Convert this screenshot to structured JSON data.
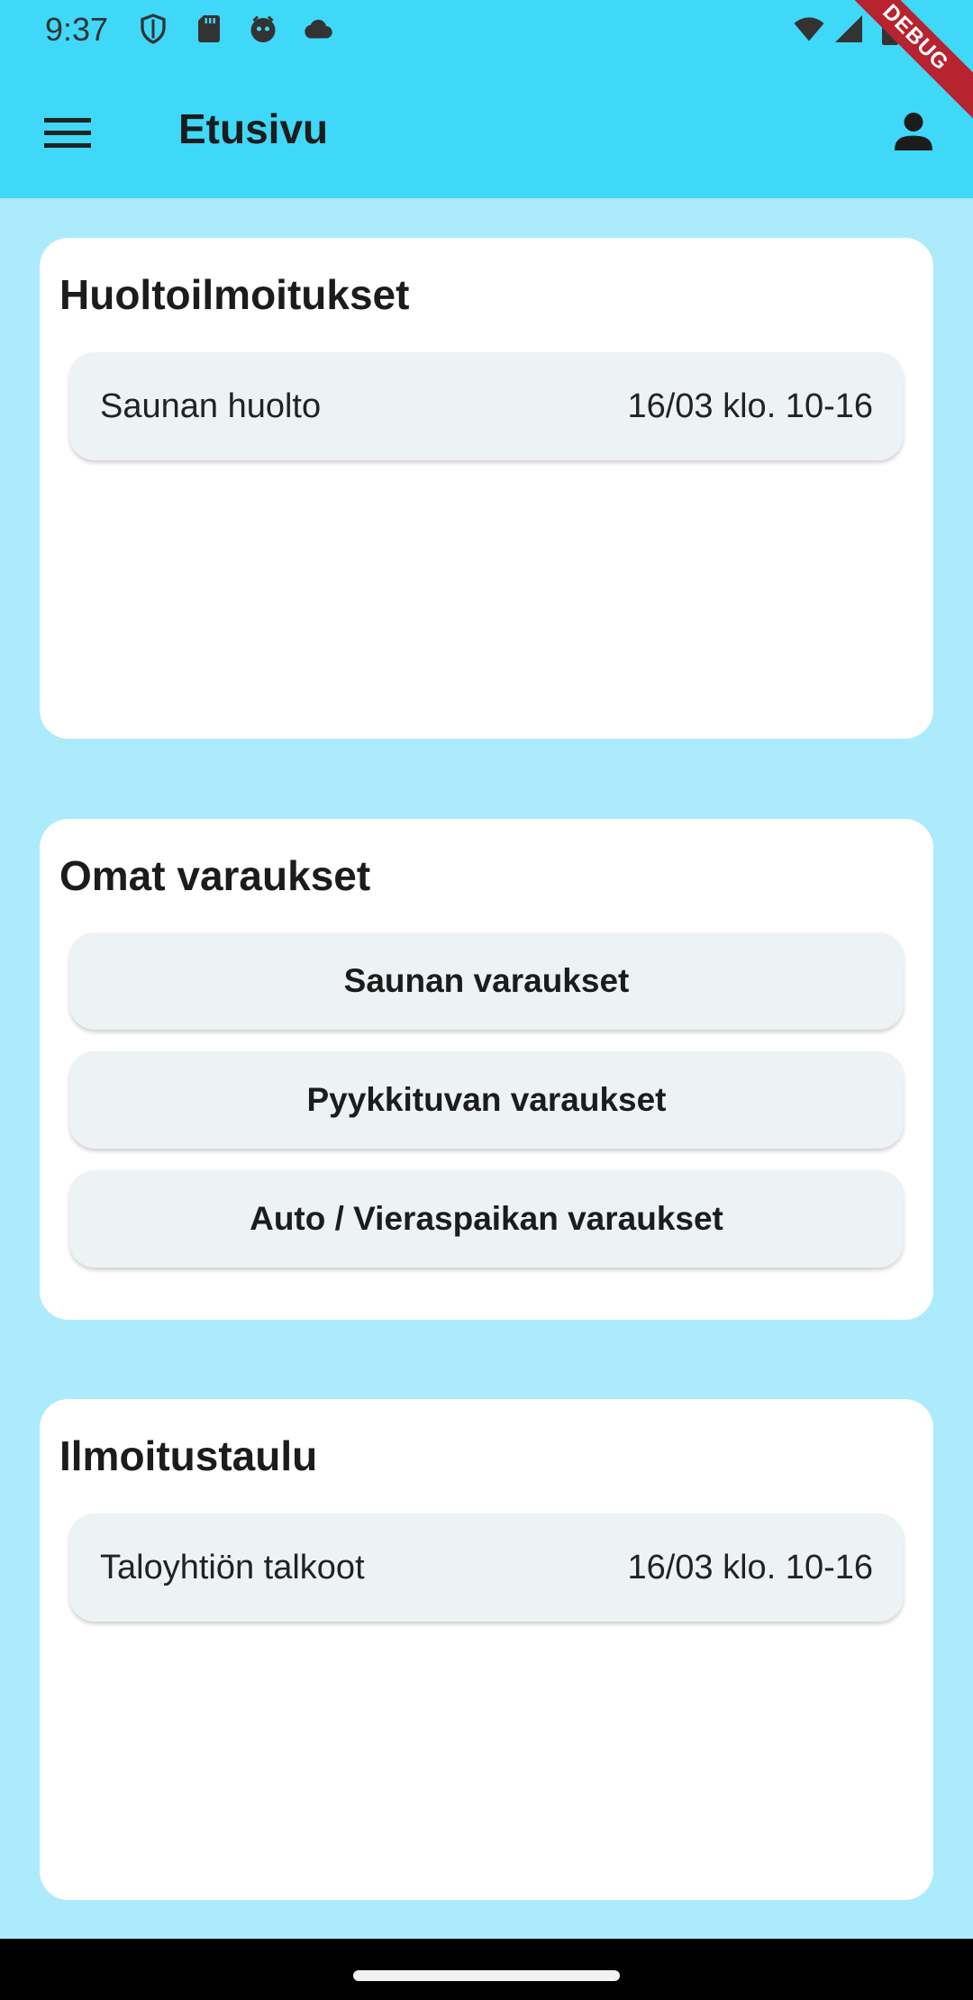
{
  "status_bar": {
    "time": "9:37",
    "icons": [
      "shield-icon",
      "sd-card-icon",
      "face-icon",
      "cloud-icon",
      "wifi-icon",
      "signal-icon",
      "battery-icon"
    ]
  },
  "app_bar": {
    "title": "Etusivu",
    "menu_icon": "menu-icon",
    "profile_icon": "person-icon",
    "debug_banner": "DEBUG"
  },
  "maintenance": {
    "title": "Huoltoilmoitukset",
    "items": [
      {
        "label": "Saunan huolto",
        "date": "16/03 klo. 10-16"
      }
    ]
  },
  "reservations": {
    "title": "Omat varaukset",
    "buttons": [
      {
        "label": "Saunan varaukset"
      },
      {
        "label": "Pyykkituvan varaukset"
      },
      {
        "label": "Auto / Vieraspaikan varaukset"
      }
    ]
  },
  "noticeboard": {
    "title": "Ilmoitustaulu",
    "items": [
      {
        "label": "Taloyhtiön talkoot",
        "date": "16/03 klo. 10-16"
      }
    ]
  },
  "colors": {
    "app_bar": "#3fd8f8",
    "background": "#abebfc",
    "card": "#ffffff",
    "row": "#edf2f5",
    "debug_banner": "#b7232f"
  }
}
